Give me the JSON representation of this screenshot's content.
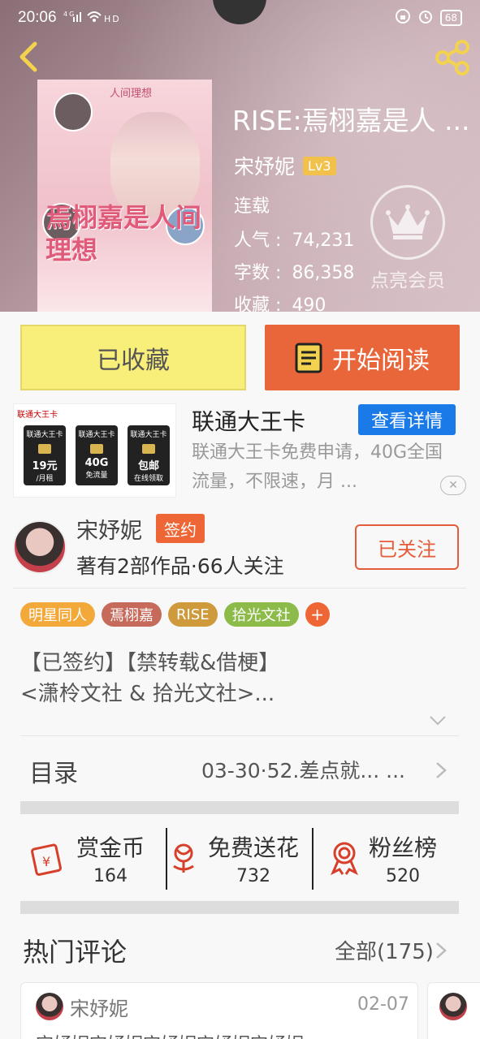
{
  "status_bar": {
    "time": "20:06",
    "network": "4G",
    "battery": "68"
  },
  "book": {
    "title": "RISE:焉栩嘉是人 ...",
    "author": "宋妤妮",
    "level": "Lv3",
    "status": "连载",
    "popularity_label": "人气",
    "popularity": "74,231",
    "words_label": "字数",
    "words": "86,358",
    "favorites_label": "收藏",
    "favorites": "490",
    "cover_title": "焉栩嘉是人间理想",
    "cover_top": "人间理想",
    "colon": ":"
  },
  "vip": {
    "label": "点亮会员"
  },
  "actions": {
    "collected": "已收藏",
    "start_reading": "开始阅读"
  },
  "ad": {
    "brand": "联通大王卡",
    "sims": [
      {
        "name": "联通大王卡",
        "value": "19元",
        "sub": "/月租"
      },
      {
        "name": "联通大王卡",
        "value": "40G",
        "sub": "免流量"
      },
      {
        "name": "联通大王卡",
        "value": "包邮",
        "sub": "在线领取"
      }
    ],
    "title": "联通大王卡",
    "detail_button": "查看详情",
    "description": "联通大王卡免费申请，40G全国流量，不限速，月 ..."
  },
  "author_row": {
    "name": "宋妤妮",
    "signed": "签约",
    "stats": "著有2部作品·66人关注",
    "follow_button": "已关注"
  },
  "tags": [
    {
      "label": "明星同人",
      "color": "#f3a93a"
    },
    {
      "label": "焉栩嘉",
      "color": "#c66a5b"
    },
    {
      "label": "RISE",
      "color": "#cf9a3c"
    },
    {
      "label": "拾光文社",
      "color": "#8dbb4a"
    }
  ],
  "tag_add": "+",
  "intro": {
    "line1": "【已签约】【禁转载&借梗】",
    "line2": "<潇柃文社 & 拾光文社>..."
  },
  "toc": {
    "label": "目录",
    "latest": "03-30·52.差点就... ..."
  },
  "stats": [
    {
      "label": "赏金币",
      "value": "164"
    },
    {
      "label": "免费送花",
      "value": "732"
    },
    {
      "label": "粉丝榜",
      "value": "520"
    }
  ],
  "hot_comments": {
    "title": "热门评论",
    "all_label": "全部(175)",
    "items": [
      {
        "user": "宋妤妮",
        "date": "02-07",
        "text": "宋妤妮宋妤妮宋妤妮宋妤妮宋妤妮"
      }
    ]
  },
  "colors": {
    "accent": "#e8663a",
    "collected_bg": "#f8ee7a",
    "detail_blue": "#1a7be8",
    "level_gold": "#f1c14b"
  }
}
